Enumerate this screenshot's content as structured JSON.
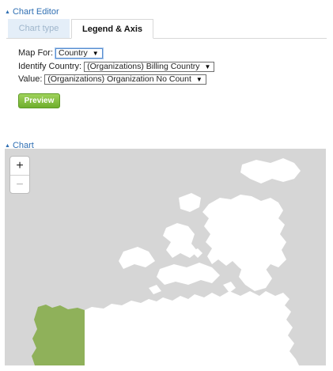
{
  "editor": {
    "title": "Chart Editor"
  },
  "tabs": [
    {
      "label": "Chart type",
      "active": false
    },
    {
      "label": "Legend & Axis",
      "active": true
    }
  ],
  "form": {
    "map_for": {
      "label": "Map For:",
      "value": "Country"
    },
    "identify_country": {
      "label": "Identify Country:",
      "value": "(Organizations) Billing Country"
    },
    "value": {
      "label": "Value:",
      "value": "(Organizations) Organization No Count"
    }
  },
  "preview_label": "Preview",
  "chart": {
    "title": "Chart"
  },
  "map": {
    "zoom_in": "+",
    "zoom_out": "−",
    "colors": {
      "water": "#d6d6d6",
      "land": "#ffffff",
      "highlight": "#8fb15a"
    }
  },
  "icons": {
    "collapse": "caret-up-icon",
    "dropdown": "dropdown-arrow-icon"
  }
}
